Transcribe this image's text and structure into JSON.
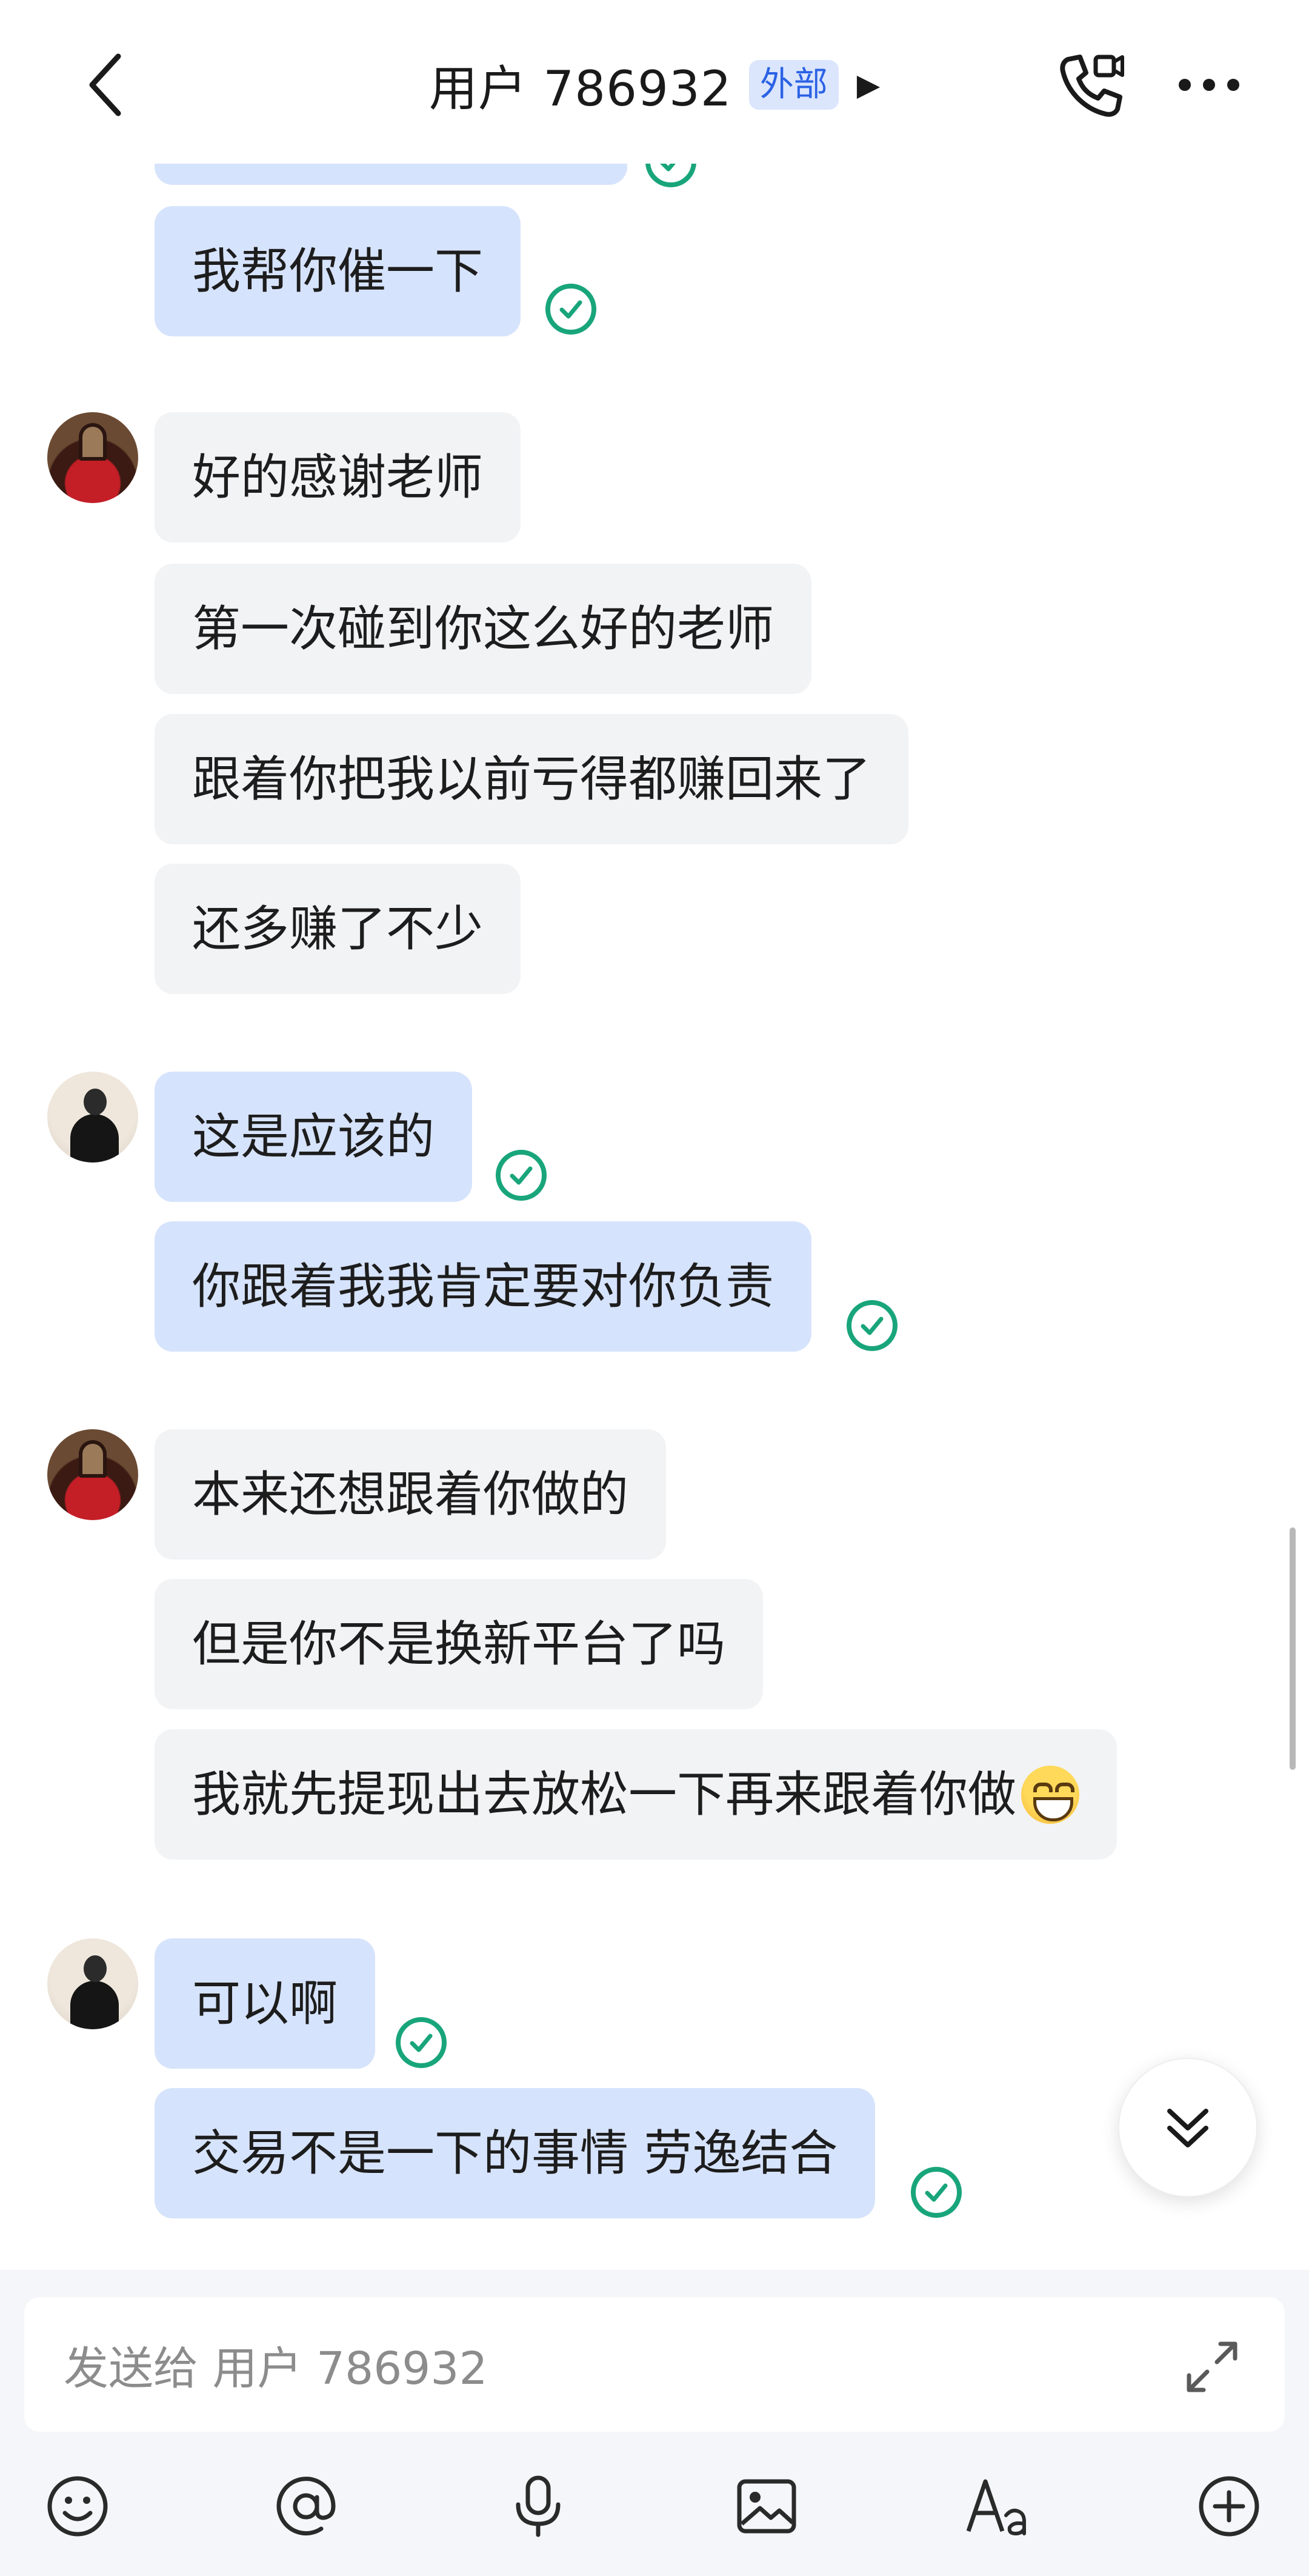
{
  "header": {
    "title": "用户 786932",
    "badge": "外部",
    "arrow": "▶",
    "icons": [
      "back-icon",
      "video-call-icon",
      "more-icon"
    ]
  },
  "messages": [
    {
      "from": "me",
      "text": "我帮你催一下",
      "status": "read"
    },
    {
      "from": "them",
      "text": "好的感谢老师"
    },
    {
      "from": "them",
      "text": "第一次碰到你这么好的老师"
    },
    {
      "from": "them",
      "text": "跟着你把我以前亏得都赚回来了"
    },
    {
      "from": "them",
      "text": "还多赚了不少"
    },
    {
      "from": "me",
      "text": "这是应该的",
      "status": "read"
    },
    {
      "from": "me",
      "text": "你跟着我我肯定要对你负责",
      "status": "read"
    },
    {
      "from": "them",
      "text": "本来还想跟着你做的"
    },
    {
      "from": "them",
      "text": "但是你不是换新平台了吗"
    },
    {
      "from": "them",
      "text": "我就先提现出去放松一下再来跟着你做",
      "emoji": "grinning-face"
    },
    {
      "from": "me",
      "text": "可以啊",
      "status": "read"
    },
    {
      "from": "me",
      "text": "交易不是一下的事情 劳逸结合",
      "status": "read"
    }
  ],
  "composer": {
    "placeholder": "发送给 用户 786932"
  },
  "toolbar": {
    "icons": [
      "emoji-icon",
      "mention-icon",
      "microphone-icon",
      "image-icon",
      "text-format-icon",
      "add-icon"
    ]
  },
  "colors": {
    "my_bubble": "#d6e3fc",
    "their_bubble": "#f2f3f5",
    "read_check": "#19a57b",
    "badge_text": "#2b62e5",
    "badge_bg": "#dbe6fd"
  }
}
